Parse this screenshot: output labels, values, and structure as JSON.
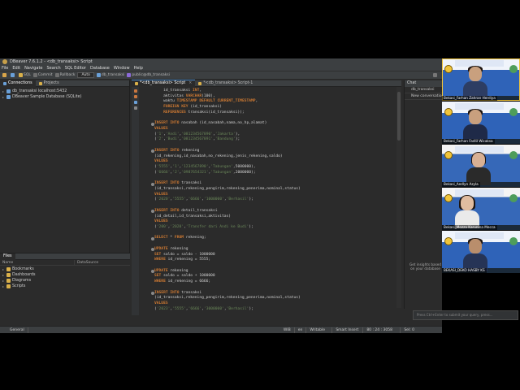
{
  "window": {
    "title": "DBeaver 7.6.1.2 - <db_transaksi> Script"
  },
  "menu": [
    "File",
    "Edit",
    "Navigate",
    "Search",
    "SQL Editor",
    "Database",
    "Window",
    "Help"
  ],
  "toolbar": {
    "sql_label": "SQL",
    "commit_label": "Commit",
    "rollback_label": "Rollback",
    "mode_value": "Auto",
    "datasource_value": "db_transaksi",
    "schema_value": "public@db_transaksi"
  },
  "left_panel": {
    "tabs": [
      "Connections",
      "Projects"
    ],
    "tree": [
      {
        "label": "db_transaksi  localhost:5432",
        "icon": "database-icon",
        "depth": 0
      },
      {
        "label": "DBeaver Sample Database (SQLite)",
        "icon": "database-icon",
        "depth": 0
      }
    ]
  },
  "files_panel": {
    "tab": "Files",
    "columns": [
      "Name",
      "DataSource"
    ],
    "items": [
      "Bookmarks",
      "Dashboards",
      "Diagrams",
      "Scripts"
    ]
  },
  "editor": {
    "tabs": [
      "*<db_transaksi> Script",
      "*<db_transaksi> Script-1"
    ],
    "lines": [
      "    id_transaksi INT,",
      "    aktivitas VARCHAR(100),",
      "    waktu TIMESTAMP DEFAULT CURRENT_TIMESTAMP,",
      "    FOREIGN KEY (id_transaksi)",
      "    REFERENCES transaksi(id_transaksi));",
      "",
      "INSERT INTO nasabah (id_nasabah,nama,no_hp,alamat)",
      "VALUES",
      "('1','Andi','081234567890','Jakarta'),",
      "('2','Budi','081234567891','Bandung');",
      "",
      "INSERT INTO rekening",
      "(id_rekening,id_nasabah,no_rekening,jenis_rekening,saldo)",
      "VALUES",
      "('5555','1','1234567890','Tabungan',5000000),",
      "('6666','2','0987654321','Tabungan',2000000);",
      "",
      "INSERT INTO transaksi",
      "(id_transaksi,rekening_pengirim,rekening_penerima,nominal,status)",
      "VALUES",
      "('2020','5555','6666','1000000','Berhasil');",
      "",
      "INSERT INTO detail_transaksi",
      "(id_detail,id_transaksi,aktivitas)",
      "VALUES",
      "('200','2020','Transfer dari Andi ke Budi');",
      "",
      "SELECT * FROM rekening;",
      "",
      "UPDATE rekening",
      "SET saldo = saldo - 1000000",
      "WHERE id_rekening = 5555;",
      "",
      "UPDATE rekening",
      "SET saldo = saldo + 1000000",
      "WHERE id_rekening = 6666;",
      "",
      "INSERT INTO transaksi",
      "(id_transaksi,rekening_pengirim,rekening_penerima,nominal,status)",
      "VALUES",
      "('2023','5555','6666','3000000','Berhasil');"
    ]
  },
  "ai_panel": {
    "tab": "Chat",
    "items": [
      "db_transaksi",
      "New conversation"
    ],
    "insight": "Get insights based on your database",
    "prompt_placeholder": "Press Ctrl+Enter to submit your query, press..."
  },
  "statusbar": {
    "tz": "General",
    "cells": [
      "WIB",
      "en",
      "Writable",
      "Smart Insert",
      "80 : 24 : 3058",
      "Sel: 0"
    ]
  },
  "participants": [
    {
      "name": "Bekasi_Farhan Zahran Herdiya"
    },
    {
      "name": "Bekasi_Farhan Fadlil Wicaksa"
    },
    {
      "name": "Bekasi_Aedlyn Azyla"
    },
    {
      "name": "Bekasi_Mozza Karunina Mecca"
    },
    {
      "name": "BEKASI_DEKO HASBY KS"
    }
  ]
}
